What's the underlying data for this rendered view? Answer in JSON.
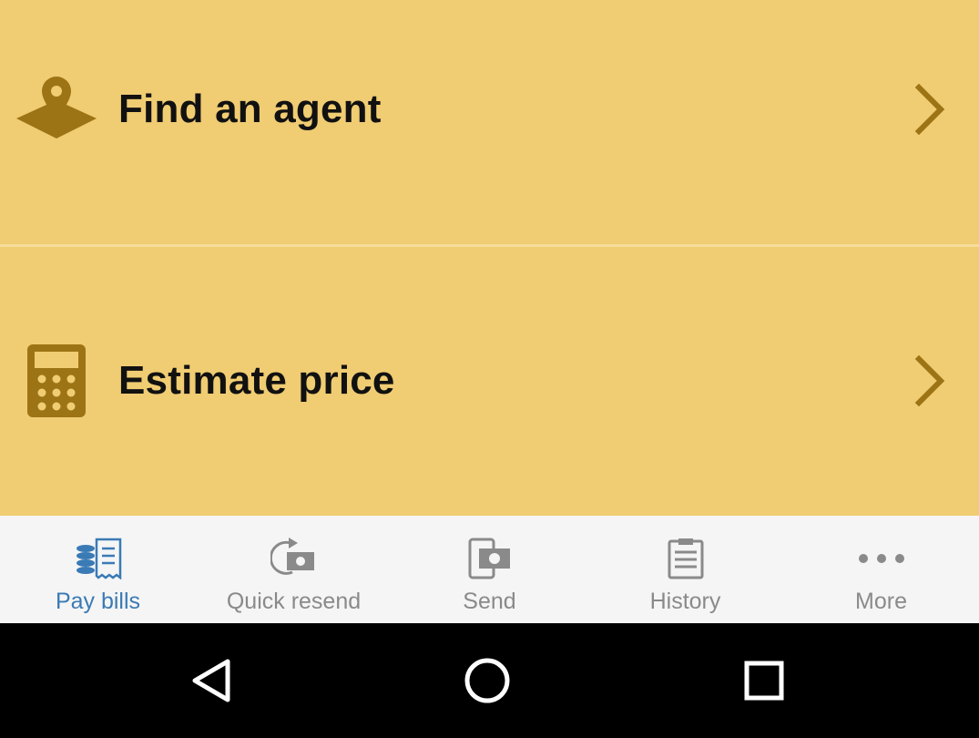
{
  "menu": {
    "items": [
      {
        "label": "Find an agent",
        "icon": "map-pin-icon"
      },
      {
        "label": "Estimate price",
        "icon": "calculator-icon"
      }
    ]
  },
  "bottom_nav": {
    "items": [
      {
        "label": "Pay bills",
        "icon": "pay-bills-icon",
        "active": true
      },
      {
        "label": "Quick resend",
        "icon": "quick-resend-icon",
        "active": false
      },
      {
        "label": "Send",
        "icon": "send-icon",
        "active": false
      },
      {
        "label": "History",
        "icon": "history-icon",
        "active": false
      },
      {
        "label": "More",
        "icon": "more-icon",
        "active": false
      }
    ]
  },
  "system_nav": {
    "buttons": [
      "back-icon",
      "home-icon",
      "recent-apps-icon"
    ]
  },
  "colors": {
    "background": "#f0cc72",
    "icon_gold": "#9c7415",
    "active_blue": "#3a7ab5",
    "inactive_gray": "#8a8a8a",
    "nav_background": "#f5f5f5"
  }
}
